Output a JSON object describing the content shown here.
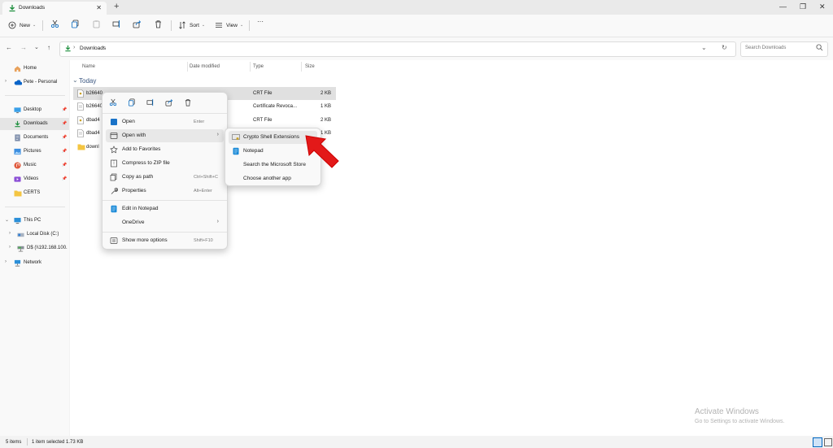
{
  "tab": {
    "title": "Downloads",
    "close": "✕",
    "new_tab": "+"
  },
  "window_controls": {
    "minimize": "—",
    "maximize": "❐",
    "close": "✕"
  },
  "command_bar": {
    "new_label": "New",
    "sort_label": "Sort",
    "view_label": "View",
    "more_label": "···"
  },
  "address": {
    "path_segment": "Downloads",
    "chevron": "›"
  },
  "search": {
    "placeholder": "Search Downloads"
  },
  "sidebar": {
    "home": "Home",
    "onedrive": "Pete - Personal",
    "quick": [
      {
        "label": "Desktop"
      },
      {
        "label": "Downloads"
      },
      {
        "label": "Documents"
      },
      {
        "label": "Pictures"
      },
      {
        "label": "Music"
      },
      {
        "label": "Videos"
      },
      {
        "label": "CERTS"
      }
    ],
    "this_pc": "This PC",
    "local_disk": "Local Disk (C:)",
    "net_drive": "D$ (\\\\192.168.100.",
    "network": "Network"
  },
  "columns": {
    "name": "Name",
    "date": "Date modified",
    "type": "Type",
    "size": "Size"
  },
  "group": {
    "label": "Today"
  },
  "files": [
    {
      "name": "b26640",
      "type": "CRT File",
      "size": "2 KB",
      "selected": true
    },
    {
      "name": "b26640",
      "type": "Certificate Revoca...",
      "size": "1 KB"
    },
    {
      "name": "dbad4",
      "type": "CRT File",
      "size": "2 KB"
    },
    {
      "name": "dbad4",
      "type": "",
      "size": "1 KB"
    },
    {
      "name": "downl",
      "type": "",
      "size": ""
    }
  ],
  "context_menu": {
    "open": "Open",
    "open_key": "Enter",
    "open_with": "Open with",
    "add_favorites": "Add to Favorites",
    "compress": "Compress to ZIP file",
    "copy_path": "Copy as path",
    "copy_path_key": "Ctrl+Shift+C",
    "properties": "Properties",
    "properties_key": "Alt+Enter",
    "edit_notepad": "Edit in Notepad",
    "onedrive": "OneDrive",
    "show_more": "Show more options",
    "show_more_key": "Shift+F10"
  },
  "submenu": {
    "items": [
      {
        "label": "Crypto Shell Extensions"
      },
      {
        "label": "Notepad"
      },
      {
        "label": "Search the Microsoft Store"
      },
      {
        "label": "Choose another app"
      }
    ]
  },
  "status": {
    "items": "5 items",
    "selected": "1 item selected  1.73 KB"
  },
  "watermark": {
    "line1": "Activate Windows",
    "line2": "Go to Settings to activate Windows."
  },
  "colors": {
    "accent": "#0067c0",
    "arrow": "#e31919",
    "selection": "#e0e0e0"
  }
}
